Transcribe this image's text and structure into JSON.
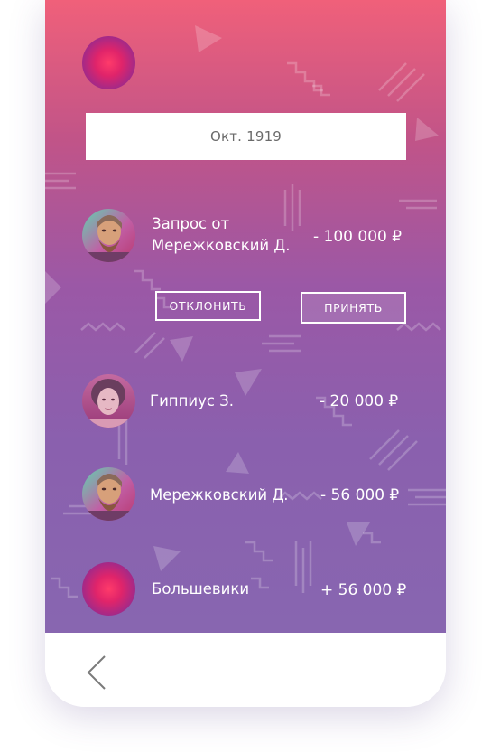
{
  "header": {
    "date_label": "Окт. 1919"
  },
  "request": {
    "title_line1": "Запрос от",
    "title_line2": "Мережковский Д.",
    "amount": "- 100 000 ₽",
    "decline_label": "ОТКЛОНИТЬ",
    "accept_label": "ПРИНЯТЬ"
  },
  "transactions": [
    {
      "name": "Гиппиус З.",
      "amount": "- 20 000 ₽"
    },
    {
      "name": "Мережковский Д.",
      "amount": "- 56 000 ₽"
    },
    {
      "name": "Большевики",
      "amount": "+ 56 000 ₽"
    }
  ],
  "icons": {
    "back": "chevron-left-icon"
  },
  "colors": {
    "gradient_top": "#f0607a",
    "gradient_bottom": "#8866b0",
    "accent_circle": "#e0246a"
  }
}
